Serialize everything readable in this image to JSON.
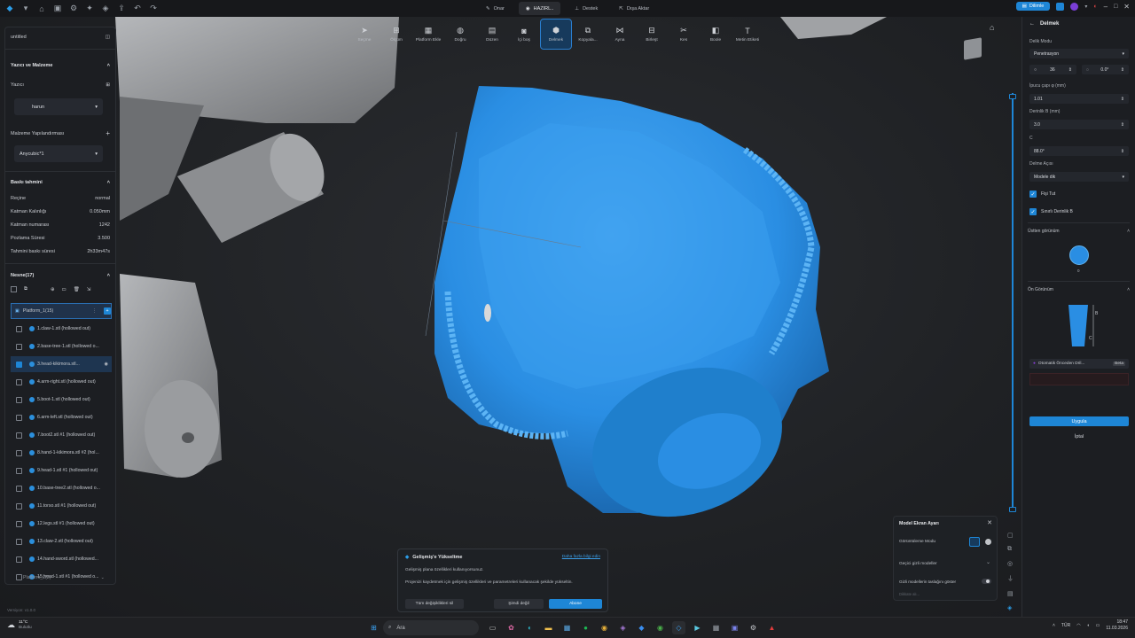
{
  "topbar": {
    "tabs": [
      {
        "label": "Onar",
        "active": false
      },
      {
        "label": "HAZIRL..",
        "active": true
      },
      {
        "label": "Destek",
        "active": false
      },
      {
        "label": "Dışa Aktar",
        "active": false
      }
    ],
    "slice_button": "Dilimle"
  },
  "toolbar": {
    "tools": [
      {
        "label": "Seçme",
        "icon": "cursor-icon"
      },
      {
        "label": "Ölçüm",
        "icon": "ruler-icon"
      },
      {
        "label": "Platform Ekle",
        "icon": "platform-add-icon"
      },
      {
        "label": "Doğru",
        "icon": "level-icon"
      },
      {
        "label": "Düzen",
        "icon": "arrange-icon"
      },
      {
        "label": "İçi boş",
        "icon": "hollow-icon"
      },
      {
        "label": "Delmek",
        "icon": "drill-icon",
        "active": true
      },
      {
        "label": "Kopyala...",
        "icon": "copy-icon"
      },
      {
        "label": "Ayna",
        "icon": "mirror-icon"
      },
      {
        "label": "Birleşt",
        "icon": "merge-icon"
      },
      {
        "label": "Kes",
        "icon": "cut-icon"
      },
      {
        "label": "Boole",
        "icon": "boolean-icon"
      },
      {
        "label": "Metin Etiketi",
        "icon": "text-label-icon"
      }
    ]
  },
  "left_panel": {
    "project_name": "untitled",
    "printer_section": "Yazıcı ve Malzeme",
    "printer_label": "Yazıcı",
    "printer_value": "harun",
    "material_label": "Malzeme Yapılandırması",
    "material_value": "Anycubic*1",
    "estimate_section": "Baskı tahmini",
    "estimate_rows": [
      {
        "label": "Reçine",
        "value": "normal"
      },
      {
        "label": "Katman Kalınlığı",
        "value": "0.050mm"
      },
      {
        "label": "Katman numarası",
        "value": "1242"
      },
      {
        "label": "Pozlama Süresi",
        "value": "3.500"
      },
      {
        "label": "Tahmini baskı süresi",
        "value": "2h33m47s"
      }
    ],
    "objects_section": "Nesne(17)",
    "platform_label": "Platform_1(15)",
    "objects": [
      {
        "name": "1.claw-1.stl (hollowed out)",
        "checked": false
      },
      {
        "name": "2.base-tree-1.stl (hollowed o...",
        "checked": false
      },
      {
        "name": "3.head-kikimora.stl...",
        "checked": true
      },
      {
        "name": "4.arm-right.stl (hollowed out)",
        "checked": false
      },
      {
        "name": "5.boot-1.stl (hollowed out)",
        "checked": false
      },
      {
        "name": "6.arm-left.stl (hollowed out)",
        "checked": false
      },
      {
        "name": "7.boot2.stl #1 (hollowed out)",
        "checked": false
      },
      {
        "name": "8.hand-1-kikimora.stl #2 (hol...",
        "checked": false
      },
      {
        "name": "9.head-1.stl #1 (hollowed out)",
        "checked": false
      },
      {
        "name": "10.base-tree2.stl (hollowed o...",
        "checked": false
      },
      {
        "name": "11.torso.stl #1 (hollowed out)",
        "checked": false
      },
      {
        "name": "12.legs.stl #1 (hollowed out)",
        "checked": false
      },
      {
        "name": "13.claw-2.stl (hollowed out)",
        "checked": false
      },
      {
        "name": "14.hand-sword.stl (hollowed...",
        "checked": false
      },
      {
        "name": "15.head-1.stl #1 (hollowed o...",
        "checked": false
      }
    ],
    "platform2_label": "Platform_2(2)",
    "version": "Versiyon: v1.0.0"
  },
  "right_panel": {
    "title": "Delmek",
    "hole_mode_label": "Delik Modu",
    "hole_mode_value": "Penetrasyon",
    "segments_value": "36",
    "angle_value": "0.0°",
    "inner_diameter_label": "İpucu çapı φ (mm)",
    "inner_diameter_value": "1.01",
    "depth_label": "Derinlik B (mm)",
    "depth_value": "3.0",
    "c_label": "C",
    "c_value": "88.0°",
    "drill_angle_label": "Delme Açısı",
    "drill_angle_value": "Modele dik",
    "keep_tip_label": "Fişi Tut",
    "fixed_depth_label": "Sınırlı Derinlik B",
    "top_view_label": "Üstten görünüm",
    "top_view_value": "0",
    "front_view_label": "Ön Görünüm",
    "front_view_b": "B",
    "front_view_c": "C",
    "auto_preview_label": "Otomatik Önceden Dril...",
    "beta_badge": "Beta",
    "apply_button": "Uygula",
    "cancel_button": "İptal"
  },
  "upgrade_popup": {
    "title": "Gelişmiş'e Yükseltme",
    "link": "Daha fazla bilgi edin",
    "line1": "Gelişmiş plana özellikleri kullanıyorsunuz.",
    "line2": "Projenizi kaydetmek için gelişmiş özellikleri ve parametreleri kullanacak şekilde yükseltin.",
    "btn_cancel": "Tüm değişiklikleri sil",
    "btn_later": "Şimdi değil",
    "btn_subscribe": "Abone"
  },
  "display_popup": {
    "title": "Model Ekran Ayarı",
    "view_mode_label": "Görüntüleme Modu",
    "transparent_label": "Geçici gizli modeller",
    "show_hidden_label": "Gizli modellerin taslağını göster",
    "hint": "Dikkate alı..."
  },
  "taskbar": {
    "weather_temp": "11°C",
    "weather_desc": "Bulutlu",
    "search_placeholder": "Ara",
    "lang": "TÜR",
    "time": "18:47",
    "date": "11.03.2026"
  },
  "colors": {
    "accent": "#1e86d6",
    "model_blue": "#2a8ee3",
    "model_grey": "#8f9194"
  }
}
